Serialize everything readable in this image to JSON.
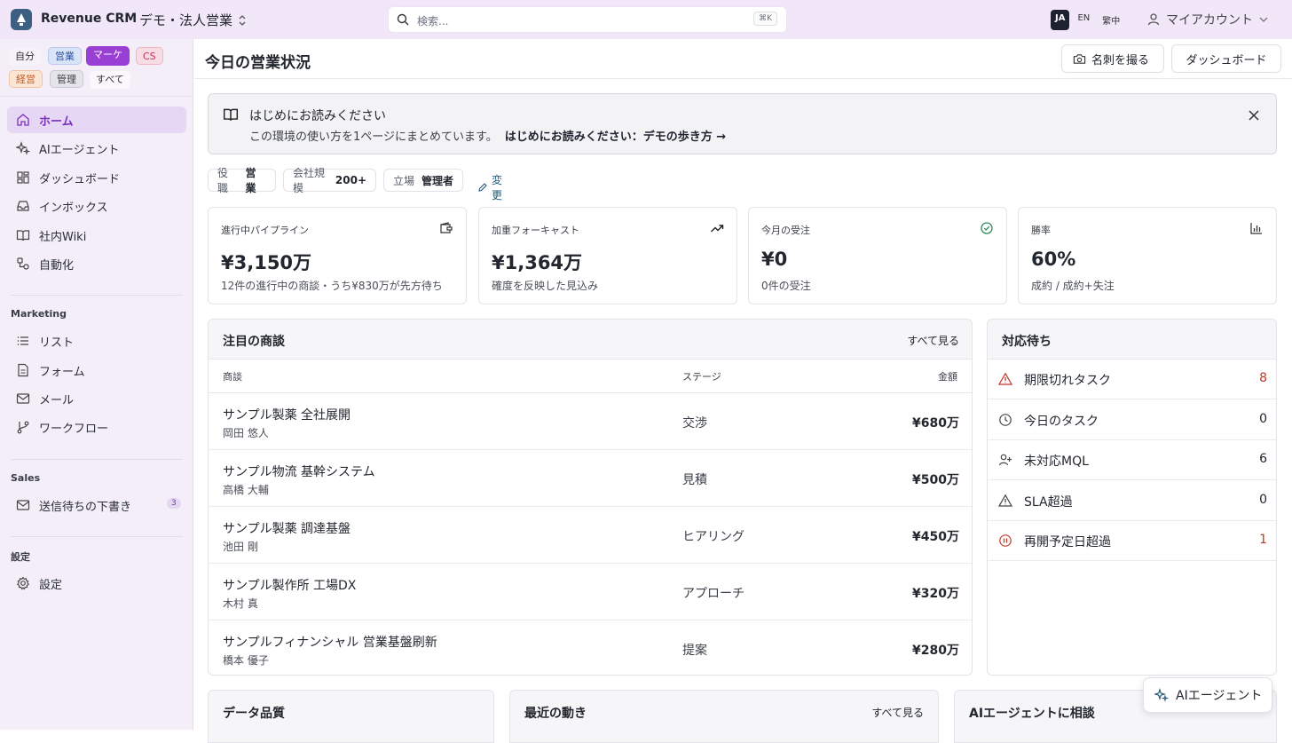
{
  "app": {
    "title": "Revenue CRM",
    "workspace": "デモ・法人営業"
  },
  "search": {
    "placeholder": "検索...",
    "shortcut": "⌘K"
  },
  "languages": [
    {
      "code": "JA",
      "active": true
    },
    {
      "code": "EN",
      "active": false
    },
    {
      "code": "繁中",
      "active": false
    }
  ],
  "account": {
    "label": "マイアカウント"
  },
  "roles": {
    "me": "自分",
    "sales": "営業",
    "marketing": "マーケ",
    "cs": "CS",
    "exec": "経営",
    "admin": "管理",
    "all": "すべて"
  },
  "nav": {
    "home": "ホーム",
    "ai_agent": "AIエージェント",
    "dashboard": "ダッシュボード",
    "inbox": "インボックス",
    "wiki": "社内Wiki",
    "automation": "自動化",
    "marketing_section": "Marketing",
    "lists": "リスト",
    "forms": "フォーム",
    "mail": "メール",
    "workflow": "ワークフロー",
    "sales_section": "Sales",
    "drafts": "送信待ちの下書き",
    "drafts_count": "3",
    "settings_section": "設定",
    "settings": "設定"
  },
  "header": {
    "title": "今日の営業状況",
    "card_button": "名刺を撮る",
    "dashboard_button": "ダッシュボード"
  },
  "banner": {
    "title": "はじめにお読みください",
    "desc": "この環境の使い方を1ページにまとめています。",
    "link": "はじめにお読みください：デモの歩き方 →"
  },
  "filters": {
    "role_label": "役職",
    "role_value": "営業",
    "size_label": "会社規模",
    "size_value": "200+",
    "position_label": "立場",
    "position_value": "管理者",
    "change": "変更"
  },
  "kpis": [
    {
      "label": "進行中パイプライン",
      "value": "¥3,150万",
      "sub": "12件の進行中の商談・うち¥830万が先方待ち",
      "icon": "wallet-icon"
    },
    {
      "label": "加重フォーキャスト",
      "value": "¥1,364万",
      "sub": "確度を反映した見込み",
      "icon": "trend-up-icon"
    },
    {
      "label": "今月の受注",
      "value": "¥0",
      "sub": "0件の受注",
      "icon": "check-circle-icon"
    },
    {
      "label": "勝率",
      "value": "60%",
      "sub": "成約 / 成約+失注",
      "icon": "bar-chart-icon"
    }
  ],
  "deals": {
    "title": "注目の商談",
    "view_all": "すべて見る",
    "columns": {
      "deal": "商談",
      "stage": "ステージ",
      "amount": "金額"
    },
    "rows": [
      {
        "name": "サンプル製薬 全社展開",
        "owner": "岡田 悠人",
        "stage": "交渉",
        "amount": "¥680万"
      },
      {
        "name": "サンプル物流 基幹システム",
        "owner": "高橋 大輔",
        "stage": "見積",
        "amount": "¥500万"
      },
      {
        "name": "サンプル製薬 調達基盤",
        "owner": "池田 剛",
        "stage": "ヒアリング",
        "amount": "¥450万"
      },
      {
        "name": "サンプル製作所 工場DX",
        "owner": "木村 真",
        "stage": "アプローチ",
        "amount": "¥320万"
      },
      {
        "name": "サンプルフィナンシャル 営業基盤刷新",
        "owner": "橋本 優子",
        "stage": "提案",
        "amount": "¥280万"
      }
    ]
  },
  "todo": {
    "title": "対応待ち",
    "items": [
      {
        "label": "期限切れタスク",
        "count": "8",
        "icon": "warning-triangle-icon",
        "alert": true
      },
      {
        "label": "今日のタスク",
        "count": "0",
        "icon": "clock-icon",
        "alert": false
      },
      {
        "label": "未対応MQL",
        "count": "6",
        "icon": "user-plus-icon",
        "alert": false
      },
      {
        "label": "SLA超過",
        "count": "0",
        "icon": "warning-triangle-icon",
        "alert": false
      },
      {
        "label": "再開予定日超過",
        "count": "1",
        "icon": "pause-circle-icon",
        "alert": true
      }
    ]
  },
  "bottom_cards": {
    "quality": "データ品質",
    "activity": "最近の動き",
    "activity_all": "すべて見る",
    "ai_consult": "AIエージェントに相談"
  },
  "fab": {
    "label": "AIエージェント"
  },
  "colors": {
    "accent": "#9a3fd4",
    "topbar": "#f1e7f8",
    "sidebar": "#f3eef8",
    "alert": "#c0392b"
  }
}
